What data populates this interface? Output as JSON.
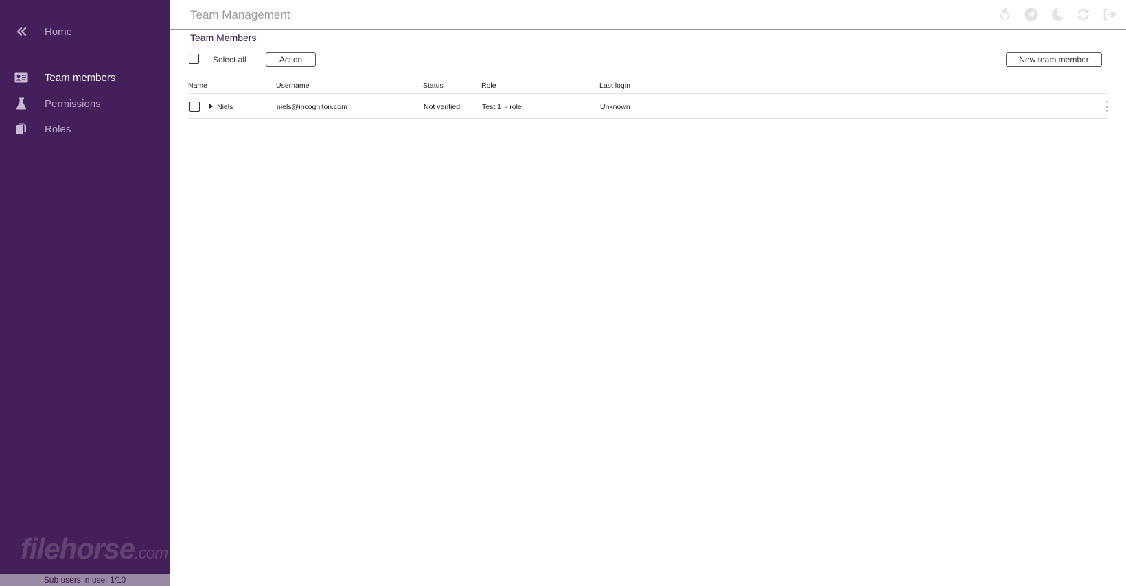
{
  "sidebar": {
    "home_label": "Home",
    "items": [
      {
        "label": "Team members",
        "icon": "id-card-icon",
        "active": true
      },
      {
        "label": "Permissions",
        "icon": "flask-icon",
        "active": false
      },
      {
        "label": "Roles",
        "icon": "documents-icon",
        "active": false
      }
    ],
    "watermark_main": "filehorse",
    "watermark_suffix": ".com",
    "footer": "Sub users in use: 1/10"
  },
  "header": {
    "title": "Team Management",
    "icons": [
      "recycle-icon",
      "send-icon",
      "moon-icon",
      "refresh-icon",
      "logout-icon"
    ]
  },
  "section": {
    "title": "Team Members"
  },
  "toolbar": {
    "select_all_label": "Select all",
    "action_label": "Action",
    "new_member_label": "New team member"
  },
  "table": {
    "columns": [
      "Name",
      "Username",
      "Status",
      "Role",
      "Last login"
    ],
    "rows": [
      {
        "name": "Niels",
        "username": "niels@incogniton.com",
        "status": "Not verified",
        "role": "Test 1  - role",
        "last_login": "Unknown"
      }
    ]
  },
  "colors": {
    "sidebar_bg": "#44205a",
    "accent": "#3b1b4f",
    "muted_text": "#b9a6c4"
  }
}
